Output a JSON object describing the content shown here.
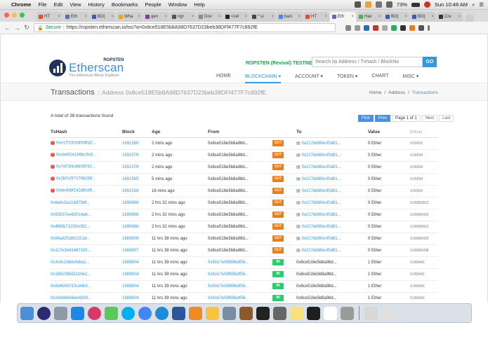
{
  "menubar": {
    "app": "Chrome",
    "items": [
      "File",
      "Edit",
      "View",
      "History",
      "Bookmarks",
      "People",
      "Window",
      "Help"
    ],
    "battery": "73%",
    "clock": "Sun 10:48 AM"
  },
  "tabs": [
    {
      "label": "HT"
    },
    {
      "label": "Eth"
    },
    {
      "label": "BO("
    },
    {
      "label": "Wha"
    },
    {
      "label": "gen"
    },
    {
      "label": "ngr"
    },
    {
      "label": "Dov"
    },
    {
      "label": "<cel"
    },
    {
      "label": "* ui"
    },
    {
      "label": "barc"
    },
    {
      "label": "HT"
    },
    {
      "label": "Eth",
      "active": true
    },
    {
      "label": "Hav"
    },
    {
      "label": "BO("
    },
    {
      "label": "BO("
    },
    {
      "label": "Cre"
    }
  ],
  "toolbar": {
    "secure": "Secure",
    "url": "https://ropsten.etherscan.io/txs?a=0x8ce518E5b8A98D7637D23beb38DFf477F7c892fE"
  },
  "header": {
    "logo_top": "ROPSTEN",
    "logo_name": "Etherscan",
    "logo_sub": "The Ethereum Block Explorer",
    "network": "ROPSTEN (Revival) TESTNET",
    "search_placeholder": "Search by Address / Txhash / BlockNo",
    "go": "GO",
    "nav": [
      "HOME",
      "BLOCKCHAIN",
      "ACCOUNT",
      "TOKEN",
      "CHART",
      "MISC"
    ]
  },
  "titlebar": {
    "title": "Transactions",
    "subtitle": ":: Address 0x8ce518E5b8A98D7637D23beb38DFf477F7c892fE",
    "crumbs": [
      "Home",
      "/",
      "Address",
      "/",
      "Transactions"
    ]
  },
  "summary": "A total of 38 transactions found",
  "pager": {
    "first": "First",
    "prev": "Prev",
    "page": "Page 1 of 1",
    "next": "Next",
    "last": "Last"
  },
  "table": {
    "headers": [
      "TxHash",
      "Block",
      "Age",
      "From",
      "",
      "To",
      "Value",
      "[TxFee]"
    ],
    "rows": [
      {
        "err": true,
        "hash": "0xe1702b3d086fa2...",
        "block": "1691580",
        "age": "2 mins ago",
        "from": "0x8ce518e5b8a98d...",
        "dir": "OUT",
        "to": "0x217dd60ecf0d81...",
        "to_contract": true,
        "value": "0 Ether",
        "fee": "0.00015"
      },
      {
        "err": true,
        "hash": "0xcbe02e166bc9c8...",
        "block": "1691579",
        "age": "2 mins ago",
        "from": "0x8ce518e5b8a98d...",
        "dir": "OUT",
        "to": "0x217dd60ecf0d81...",
        "to_contract": true,
        "value": "0 Ether",
        "fee": "0.00294"
      },
      {
        "err": true,
        "hash": "0x7d71f4cb608782...",
        "block": "1691579",
        "age": "2 mins ago",
        "from": "0x8ce518e5b8a98d...",
        "dir": "OUT",
        "to": "0x217dd60ecf0d81...",
        "to_contract": true,
        "value": "0 Ether",
        "fee": "0.00294"
      },
      {
        "err": true,
        "hash": "0x2b7cf37179b268...",
        "block": "1691565",
        "age": "5 mins ago",
        "from": "0x8ce518e5b8a98d...",
        "dir": "OUT",
        "to": "0x217dd60ecf0d81...",
        "to_contract": true,
        "value": "0 Ether",
        "fee": "0.00294"
      },
      {
        "err": true,
        "hash": "0xbe4bbf142d6cd6...",
        "block": "1691516",
        "age": "16 mins ago",
        "from": "0x8ce518e5b8a98d...",
        "dir": "OUT",
        "to": "0x217dd60ecf0d81...",
        "to_contract": true,
        "value": "0 Ether",
        "fee": "0.00294"
      },
      {
        "err": false,
        "hash": "0x6e8c5a1b1879df...",
        "block": "1690866",
        "age": "2 hrs 32 mins ago",
        "from": "0x8ce518e5b8a98d...",
        "dir": "OUT",
        "to": "0x217dd60ecf0d81...",
        "to_contract": true,
        "value": "0 Ether",
        "fee": "0.00056812"
      },
      {
        "err": false,
        "hash": "0x93537ee630c4a6...",
        "block": "1690866",
        "age": "2 hrs 32 mins ago",
        "from": "0x8ce518e5b8a98d...",
        "dir": "OUT",
        "to": "0x217dd60ecf0d81...",
        "to_contract": true,
        "value": "0 Ether",
        "fee": "0.00060425"
      },
      {
        "err": false,
        "hash": "0x4f85b71250c082...",
        "block": "1690866",
        "age": "2 hrs 32 mins ago",
        "from": "0x8ce518e5b8a98d...",
        "dir": "OUT",
        "to": "0x217dd60ecf0d81...",
        "to_contract": true,
        "value": "0 Ether",
        "fee": "0.00056812"
      },
      {
        "err": false,
        "hash": "0x94a82fcb92221d...",
        "block": "1688808",
        "age": "11 hrs 38 mins ago",
        "from": "0x8ce518e5b8a98d...",
        "dir": "OUT",
        "to": "0x217dd60ecf0d81...",
        "to_contract": true,
        "value": "0 Ether",
        "fee": "0.00060425"
      },
      {
        "err": false,
        "hash": "0x117e3b43487100...",
        "block": "1688807",
        "age": "11 hrs 38 mins ago",
        "from": "0x8ce518e5b8a98d...",
        "dir": "OUT",
        "to": "0x217dd60ecf0d81...",
        "to_contract": true,
        "value": "0 Ether",
        "fee": "0.00055008"
      },
      {
        "err": false,
        "hash": "0x3c6c18b8efdba1...",
        "block": "1688804",
        "age": "11 hrs 39 mins ago",
        "from": "0x81b7e08f65bdf56...",
        "dir": "IN",
        "to": "0x8ce518e5b8a98d...",
        "to_contract": false,
        "value": "1 Ether",
        "fee": "0.000441"
      },
      {
        "err": false,
        "hash": "0x166239b511b0e1...",
        "block": "1688804",
        "age": "11 hrs 39 mins ago",
        "from": "0x81b7e08f65bdf56...",
        "dir": "IN",
        "to": "0x8ce518e5b8a98d...",
        "to_contract": false,
        "value": "1 Ether",
        "fee": "0.000441"
      },
      {
        "err": false,
        "hash": "0x8d4b00013cd4b3...",
        "block": "1688804",
        "age": "11 hrs 39 mins ago",
        "from": "0x81b7e08f65bdf56...",
        "dir": "IN",
        "to": "0x8ce518e5b8a98d...",
        "to_contract": false,
        "value": "1 Ether",
        "fee": "0.000441"
      },
      {
        "err": false,
        "hash": "0x2e666666eb4300...",
        "block": "1688804",
        "age": "11 hrs 39 mins ago",
        "from": "0x81b7e08f65bdf56...",
        "dir": "IN",
        "to": "0x8ce518e5b8a98d...",
        "to_contract": false,
        "value": "1 Ether",
        "fee": "0.000441"
      }
    ]
  },
  "colors": {
    "accent": "#3498db",
    "out": "#e67e22",
    "in": "#2ecc71",
    "error": "#e74c3c",
    "network": "#16a34a"
  },
  "dock_icons": [
    "finder-icon",
    "siri-icon",
    "launchpad-icon",
    "app-store-icon",
    "itunes-icon",
    "messages-icon",
    "skype-icon",
    "chrome-icon",
    "safari-icon",
    "word-icon",
    "vlc-icon",
    "photos-icon",
    "preview-icon",
    "toolbox-icon",
    "terminal-icon",
    "scanner-icon",
    "notes-icon",
    "activity-monitor-icon",
    "calendar-icon",
    "script-editor-icon",
    "lockscreen-icon",
    "trash-icon"
  ]
}
